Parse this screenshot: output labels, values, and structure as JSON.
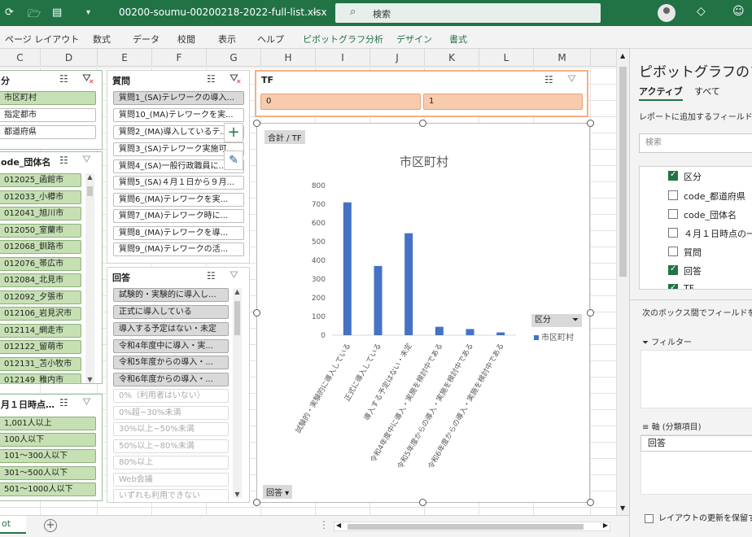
{
  "app": {
    "filename": "00200-soumu-00200218-2022-full-list.xlsx",
    "search_placeholder": "検索",
    "accent": "#217346"
  },
  "ribbon_tabs": [
    "ページ レイアウト",
    "数式",
    "データ",
    "校閲",
    "表示",
    "ヘルプ",
    "ピボットグラフ分析",
    "デザイン",
    "書式"
  ],
  "columns": [
    "C",
    "D",
    "E",
    "F",
    "G",
    "H",
    "I",
    "J",
    "K",
    "L",
    "M"
  ],
  "slicers": {
    "kubun": {
      "title": "分",
      "items": [
        "市区町村",
        "指定都市",
        "都道府県"
      ]
    },
    "dantai": {
      "title": "ode_団体名",
      "items": [
        "012025_函館市",
        "012033_小樽市",
        "012041_旭川市",
        "012050_室蘭市",
        "012068_釧路市",
        "012076_帯広市",
        "012084_北見市",
        "012092_夕張市",
        "012106_岩見沢市",
        "012114_網走市",
        "012122_留萌市",
        "012131_苫小牧市",
        "012149_稚内市"
      ]
    },
    "jiten": {
      "title": "月１日時点…",
      "items": [
        "1,001人以上",
        "100人以下",
        "101～300人以下",
        "301～500人以下",
        "501～1000人以下"
      ]
    },
    "shitsumon": {
      "title": "質問",
      "items": [
        "質問1_(SA)テレワークの導入...",
        "質問10_(MA)テレワークを実...",
        "質問2_(MA)導入しているテ...",
        "質問3_(SA)テレワーク実施可...",
        "質問4_(SA)一般行政職員に...",
        "質問5_(SA)４月１日から９月...",
        "質問6_(MA)テレワークを実...",
        "質問7_(MA)テレワーク時に...",
        "質問8_(MA)テレワークを導...",
        "質問9_(MA)テレワークの活..."
      ]
    },
    "kaitou": {
      "title": "回答",
      "items": [
        "試験的・実験的に導入し...",
        "正式に導入している",
        "導入する予定はない・未定",
        "令和4年度中に導入・実...",
        "令和5年度からの導入・...",
        "令和6年度からの導入・..."
      ],
      "items_faded": [
        "0%（利用者はいない）",
        "0%超~30%未満",
        "30%以上~50%未満",
        "50%以上~80%未満",
        "80%以上",
        "Web会議",
        "いずれも利用できない"
      ]
    },
    "tf": {
      "title": "TF",
      "items": [
        "0",
        "1"
      ]
    }
  },
  "chart": {
    "field_button": "合計 / TF",
    "axis_button": "回答",
    "legend_button": "区分",
    "legend_entry": "市区町村"
  },
  "chart_data": {
    "type": "bar",
    "title": "市区町村",
    "categories": [
      "試験的・実験的に導入している",
      "正式に導入している",
      "導入する予定はない・未定",
      "令和4年度中に導入・実施を検討中である",
      "令和5年度からの導入・実施を検討中である",
      "令和6年度からの導入・実施を検討中である"
    ],
    "series": [
      {
        "name": "市区町村",
        "values": [
          710,
          370,
          545,
          45,
          33,
          15
        ],
        "color": "#4472c4"
      }
    ],
    "ylim": [
      0,
      800
    ],
    "yticks": [
      0,
      100,
      200,
      300,
      400,
      500,
      600,
      700,
      800
    ],
    "grid": false,
    "legend": "right"
  },
  "pane": {
    "title": "ピボットグラフのフィ",
    "tab_active": "アクティブ",
    "tab_all": "すべて",
    "description": "レポートに追加するフィールドを選",
    "search_placeholder": "検索",
    "fields": [
      {
        "label": "区分",
        "checked": true
      },
      {
        "label": "code_都道府県",
        "checked": false
      },
      {
        "label": "code_団体名",
        "checked": false
      },
      {
        "label": "４月１日時点の一",
        "checked": false
      },
      {
        "label": "質問",
        "checked": false
      },
      {
        "label": "回答",
        "checked": true
      },
      {
        "label": "TF",
        "checked": true
      }
    ],
    "drag_description": "次のボックス間でフィールドをドラ",
    "filter_label": "フィルター",
    "axis_label": "軸 (分類項目)",
    "axis_item": "回答",
    "defer_label": "レイアウトの更新を保留す"
  },
  "sheet_tab": "ot"
}
